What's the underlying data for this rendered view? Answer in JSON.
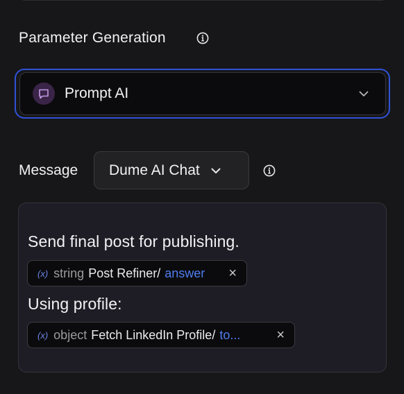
{
  "section": {
    "title": "Parameter Generation"
  },
  "generation_select": {
    "selected": "Prompt AI"
  },
  "message": {
    "label": "Message",
    "source_button": "Dume AI Chat"
  },
  "editor": {
    "line1": "Send final post for publishing.",
    "chip1": {
      "var": "(x)",
      "type": "string",
      "source": "Post Refiner/",
      "field": "answer",
      "close": "×"
    },
    "line2": "Using profile:",
    "chip2": {
      "var": "(x)",
      "type": "object",
      "source": "Fetch LinkedIn Profile/",
      "field": "to...",
      "close": "×"
    }
  },
  "colors": {
    "accent": "#2f52d8",
    "link": "#4f7df0",
    "badge": "#3a2447"
  },
  "icons": [
    "info-icon",
    "chat-bubble-icon",
    "chevron-down-icon",
    "variable-icon",
    "close-icon"
  ]
}
